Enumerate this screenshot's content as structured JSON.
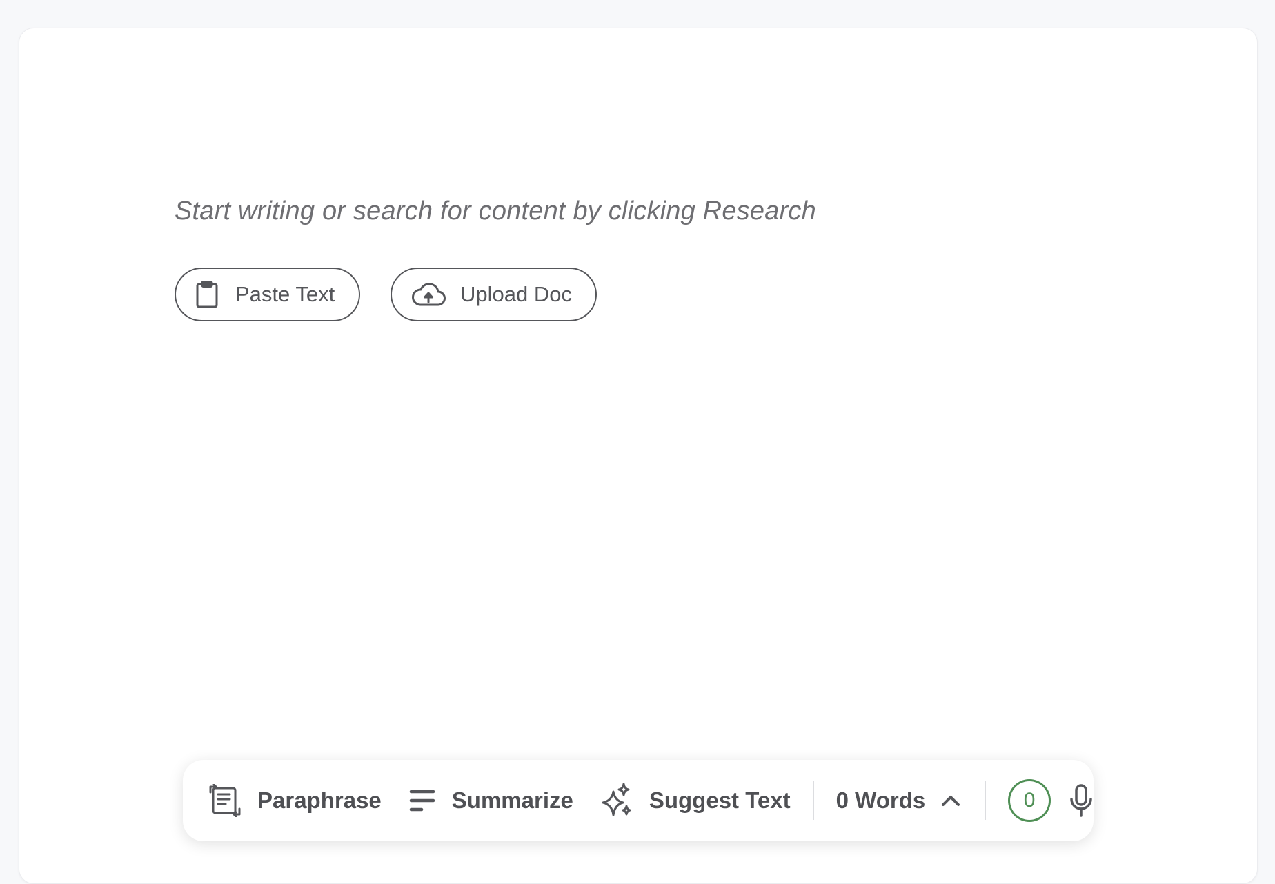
{
  "editor": {
    "placeholder": "Start writing or search for content by clicking Research"
  },
  "actions": {
    "paste_label": "Paste Text",
    "upload_label": "Upload Doc"
  },
  "toolbar": {
    "paraphrase_label": "Paraphrase",
    "summarize_label": "Summarize",
    "suggest_label": "Suggest Text",
    "word_count_label": "0 Words",
    "score_value": "0"
  },
  "icons": {
    "paste": "clipboard-icon",
    "upload": "cloud-upload-icon",
    "paraphrase": "paraphrase-icon",
    "summarize": "lines-icon",
    "suggest": "sparkle-icon",
    "expand": "chevron-up-icon",
    "mic": "microphone-icon"
  },
  "colors": {
    "text": "#55565a",
    "accent_green": "#4f8f55",
    "background": "#f7f8fa",
    "card": "#ffffff"
  }
}
